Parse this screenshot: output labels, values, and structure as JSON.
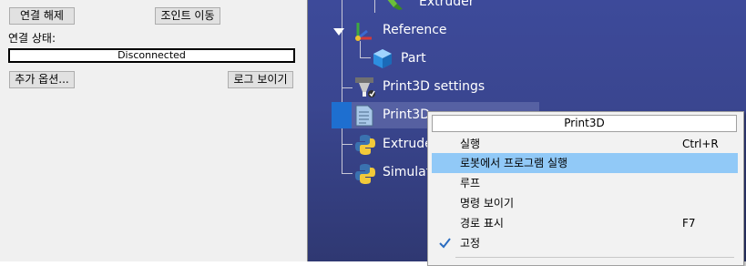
{
  "panel": {
    "disconnect_button": "연결 해제",
    "joint_move_button": "조인트 이동",
    "status_label": "연결 상태:",
    "status_value": "Disconnected",
    "more_options_button": "추가 옵션...",
    "show_log_button": "로그 보이기"
  },
  "tree": {
    "items": [
      {
        "label": "Extruder",
        "icon": "extruder-tool-icon"
      },
      {
        "label": "Reference",
        "icon": "reference-frame-icon"
      },
      {
        "label": "Part",
        "icon": "cube-object-icon"
      },
      {
        "label": "Print3D settings",
        "icon": "settings-tool-icon"
      },
      {
        "label": "Print3D",
        "icon": "program-document-icon"
      },
      {
        "label": "Extrude",
        "icon": "python-script-icon"
      },
      {
        "label": "Simulat",
        "icon": "python-script-icon"
      }
    ]
  },
  "context_menu": {
    "title": "Print3D",
    "items": [
      {
        "label": "실행",
        "shortcut": "Ctrl+R"
      },
      {
        "label": "로봇에서 프로그램 실행",
        "shortcut": ""
      },
      {
        "label": "루프",
        "shortcut": ""
      },
      {
        "label": "명령 보이기",
        "shortcut": ""
      },
      {
        "label": "경로 표시",
        "shortcut": "F7"
      },
      {
        "label": "고정",
        "shortcut": "",
        "checked": true
      }
    ]
  },
  "colors": {
    "tree_background": "#3a4690",
    "menu_highlight": "#91c9f7",
    "selection_marker": "#1e6fd0"
  }
}
